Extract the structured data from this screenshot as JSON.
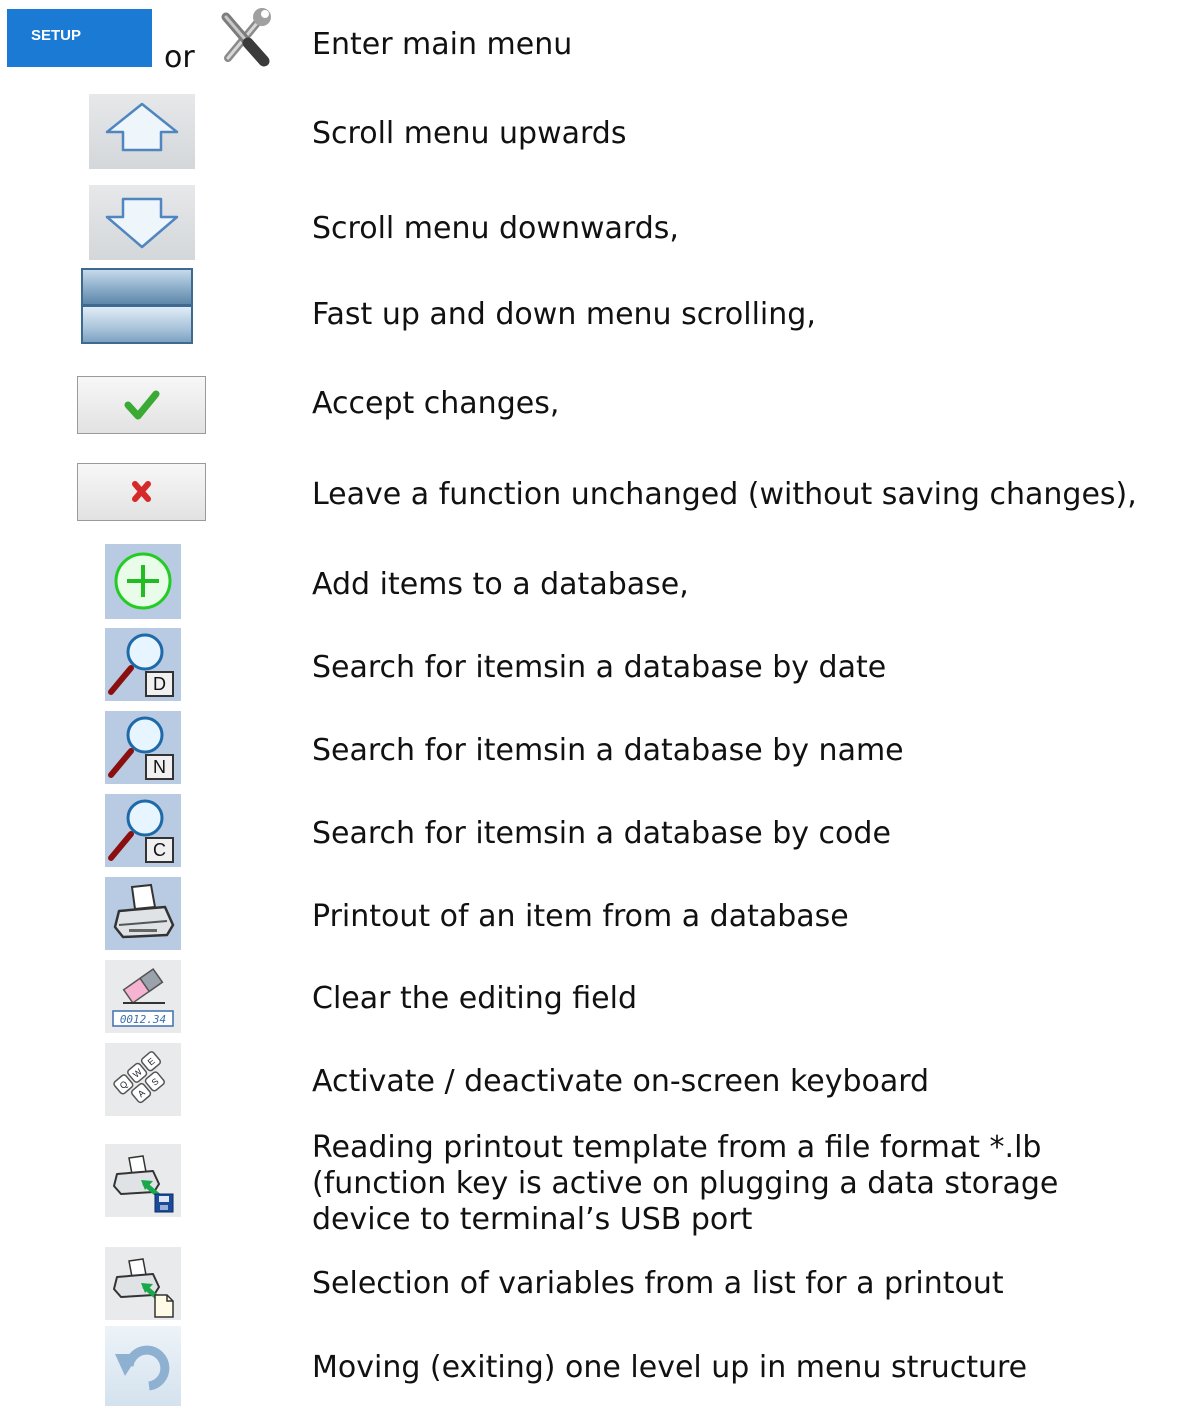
{
  "setup": {
    "button_label": "SETUP",
    "or_label": "or"
  },
  "items": [
    {
      "icon": "setup-or-tools-icon",
      "text": "Enter main menu"
    },
    {
      "icon": "arrow-up-icon",
      "text": "Scroll menu upwards"
    },
    {
      "icon": "arrow-down-icon",
      "text": "Scroll menu downwards,"
    },
    {
      "icon": "scroll-bar-icon",
      "text": "Fast up and down menu scrolling,"
    },
    {
      "icon": "checkmark-icon",
      "text": "Accept changes,"
    },
    {
      "icon": "cross-icon",
      "text": "Leave a function unchanged (without saving changes),"
    },
    {
      "icon": "add-item-icon",
      "text": "Add items to a database,"
    },
    {
      "icon": "search-date-icon",
      "badge": "D",
      "text": "Search for itemsin a database by date"
    },
    {
      "icon": "search-name-icon",
      "badge": "N",
      "text": "Search for itemsin a database by name"
    },
    {
      "icon": "search-code-icon",
      "badge": "C",
      "text": "Search for itemsin a database by code"
    },
    {
      "icon": "printer-icon",
      "text": "Printout of an item from a database"
    },
    {
      "icon": "eraser-icon",
      "display": "0012.34",
      "text": "Clear the editing field"
    },
    {
      "icon": "keyboard-icon",
      "keys": [
        "Q",
        "W",
        "E",
        "A",
        "S"
      ],
      "text": "Activate / deactivate on-screen keyboard"
    },
    {
      "icon": "printer-from-file-icon",
      "text_lines": [
        "Reading printout template from a file format *.lb",
        "(function key is active on plugging a data storage",
        "device to terminal’s USB port"
      ]
    },
    {
      "icon": "printer-variables-icon",
      "text": "Selection of variables from a list for a printout"
    },
    {
      "icon": "back-arrow-icon",
      "text": "Moving (exiting) one level up in menu structure"
    }
  ],
  "colors": {
    "setup_blue": "#1a7ad4",
    "check_green": "#3aaa35",
    "cross_red": "#d42a2a",
    "add_green": "#22cc22",
    "tile_blue": "#b8cbe3"
  }
}
